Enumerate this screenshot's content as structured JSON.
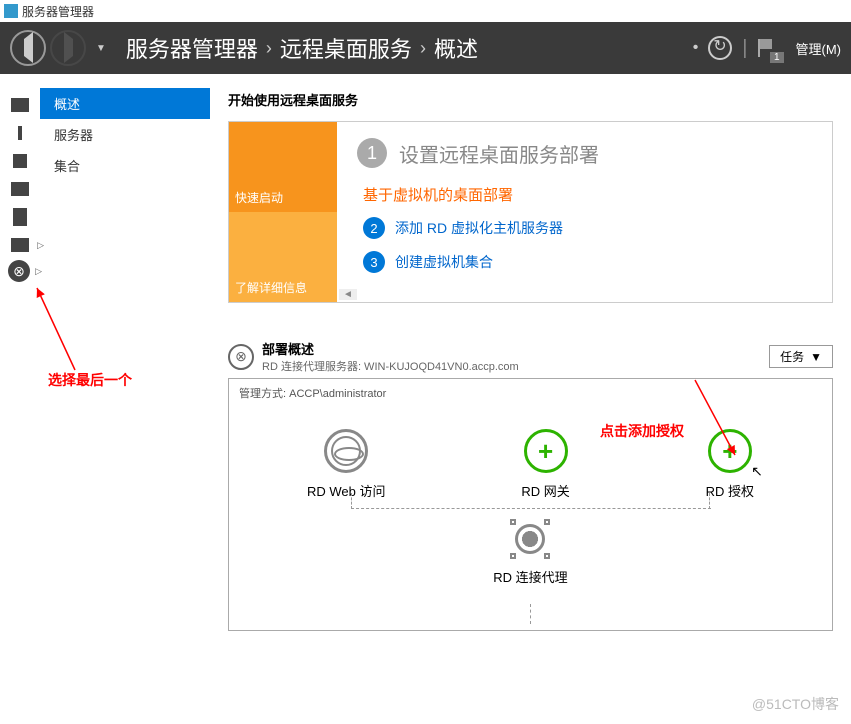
{
  "titlebar": {
    "text": "服务器管理器"
  },
  "breadcrumb": {
    "part1": "服务器管理器",
    "part2": "远程桌面服务",
    "part3": "概述"
  },
  "header": {
    "manage": "管理(M)",
    "flag_count": "1"
  },
  "sidebar": {
    "items": [
      {
        "label": "概述"
      },
      {
        "label": "服务器"
      },
      {
        "label": "集合"
      }
    ]
  },
  "content": {
    "start_title": "开始使用远程桌面服务",
    "tiles": {
      "quick": "快速启动",
      "learn": "了解详细信息"
    },
    "setup": {
      "heading": "设置远程桌面服务部署",
      "subtitle": "基于虚拟机的桌面部署",
      "steps": [
        {
          "num": "2",
          "text": "添加 RD 虚拟化主机服务器"
        },
        {
          "num": "3",
          "text": "创建虚拟机集合"
        }
      ]
    },
    "deploy": {
      "title": "部署概述",
      "sub": "RD 连接代理服务器: WIN-KUJOQD41VN0.accp.com",
      "tasks": "任务",
      "mgmt": "管理方式: ACCP\\administrator",
      "nodes": {
        "web": "RD Web 访问",
        "gateway": "RD 网关",
        "license": "RD 授权",
        "broker": "RD 连接代理"
      }
    }
  },
  "annotations": {
    "select_last": "选择最后一个",
    "click_add": "点击添加授权"
  },
  "watermark": "@51CTO博客"
}
